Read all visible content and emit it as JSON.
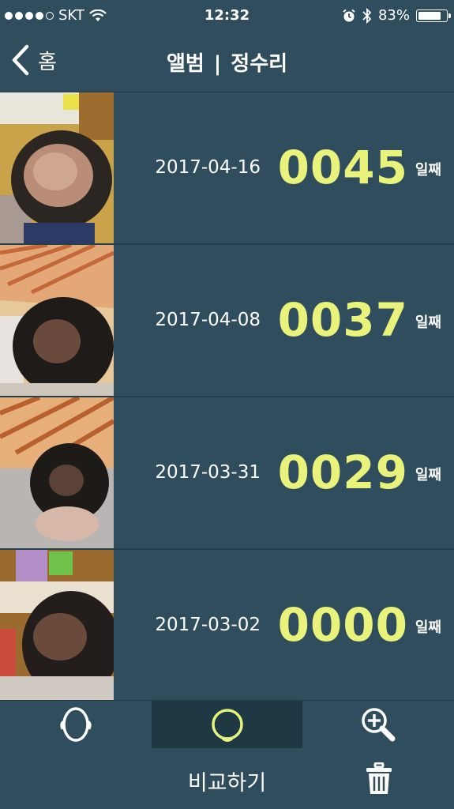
{
  "status_bar": {
    "carrier": "SKT",
    "time": "12:32",
    "battery": "83%",
    "battery_level": 0.83,
    "icons": [
      "signal-dots-icon",
      "wifi-icon",
      "alarm-icon",
      "bluetooth-icon",
      "battery-icon"
    ]
  },
  "nav": {
    "back_label": "홈",
    "title_left": "앨범",
    "title_sep": "|",
    "title_right": "정수리"
  },
  "colors": {
    "background": "#2f4d5c",
    "count_highlight": "#e9f27a",
    "active_tab": "#1e3944"
  },
  "rows": [
    {
      "date": "2017-04-16",
      "count": "0045",
      "unit": "일째"
    },
    {
      "date": "2017-04-08",
      "count": "0037",
      "unit": "일째"
    },
    {
      "date": "2017-03-31",
      "count": "0029",
      "unit": "일째"
    },
    {
      "date": "2017-03-02",
      "count": "0000",
      "unit": "일째"
    }
  ],
  "tabs": [
    {
      "icon": "head-front-icon",
      "active": false
    },
    {
      "icon": "head-top-icon",
      "active": true
    },
    {
      "icon": "zoom-in-icon",
      "active": false
    }
  ],
  "bottom": {
    "compare_label": "비교하기",
    "trash_icon": "trash-icon"
  }
}
